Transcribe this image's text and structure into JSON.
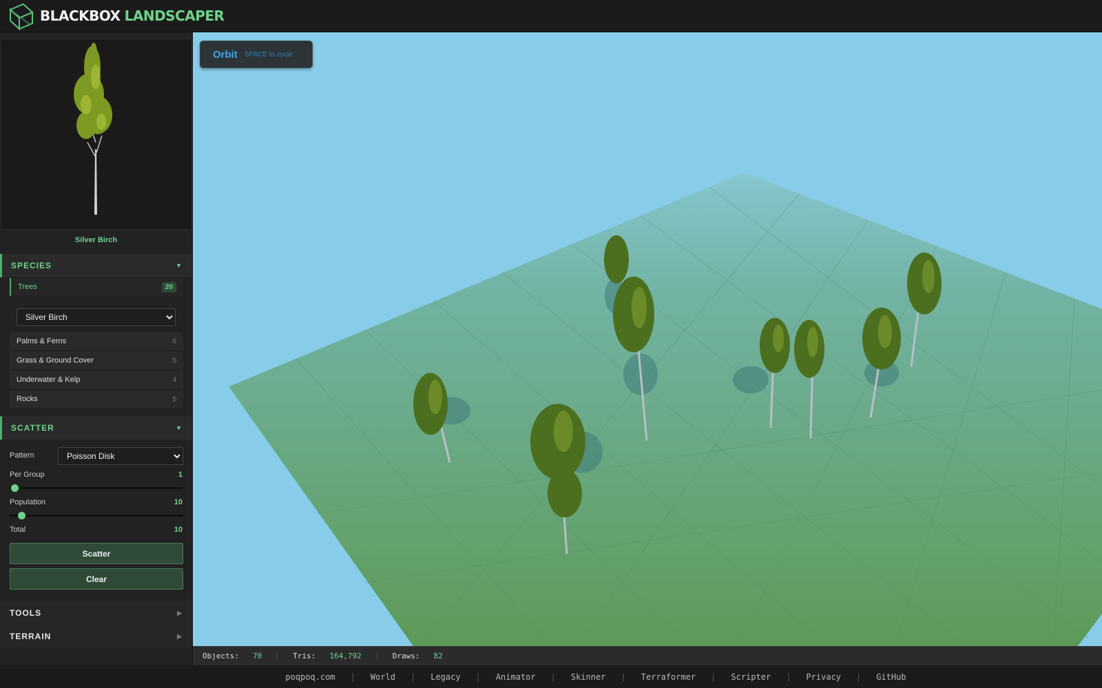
{
  "app": {
    "title_white": "BLACKBOX",
    "title_green": "LANDSCAPER",
    "logo_icon": "cube-icon"
  },
  "preview": {
    "name": "Silver Birch"
  },
  "species": {
    "header": "SPECIES",
    "active": {
      "label": "Trees",
      "count": "20",
      "selected": "Silver Birch"
    },
    "categories": [
      {
        "label": "Palms & Ferns",
        "count": "6"
      },
      {
        "label": "Grass & Ground Cover",
        "count": "5"
      },
      {
        "label": "Underwater & Kelp",
        "count": "4"
      },
      {
        "label": "Rocks",
        "count": "5"
      }
    ]
  },
  "scatter": {
    "header": "SCATTER",
    "pattern_label": "Pattern",
    "pattern_value": "Poisson Disk",
    "per_group_label": "Per Group",
    "per_group_value": "1",
    "per_group_fraction": 0.0,
    "population_label": "Population",
    "population_value": "10",
    "population_fraction": 0.04,
    "total_label": "Total",
    "total_value": "10",
    "scatter_button": "Scatter",
    "clear_button": "Clear"
  },
  "tools": {
    "header": "TOOLS"
  },
  "terrain": {
    "header": "TERRAIN"
  },
  "viewport": {
    "mode": "Orbit",
    "hint": "SPACE to cycle",
    "sky_color": "#87cde9",
    "ground_color": "#63a269"
  },
  "stats": {
    "objects_label": "Objects:",
    "objects_value": "70",
    "tris_label": "Tris:",
    "tris_value": "164,792",
    "draws_label": "Draws:",
    "draws_value": "82"
  },
  "footer": {
    "links": [
      "poqpoq.com",
      "World",
      "Legacy",
      "Animator",
      "Skinner",
      "Terraformer",
      "Scripter",
      "Privacy",
      "GitHub"
    ],
    "separator": "|"
  },
  "colors": {
    "accent": "#6fd38a",
    "accent_dark": "#4caf6c",
    "panel": "#222222"
  }
}
